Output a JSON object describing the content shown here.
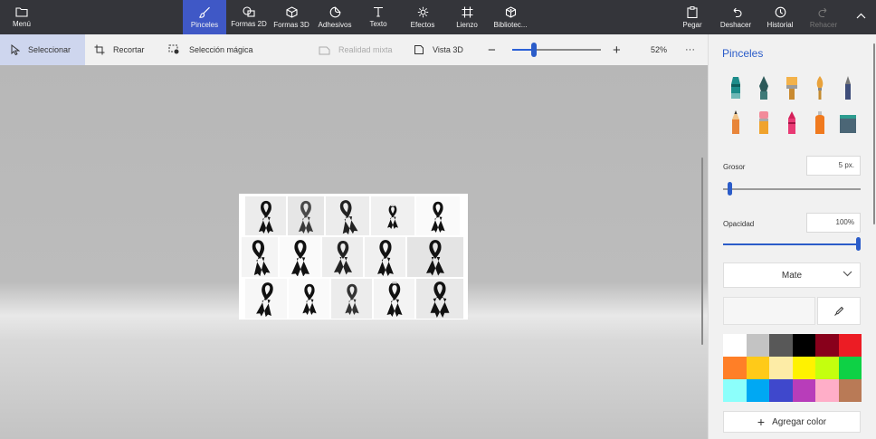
{
  "topbar": {
    "menu": "Menú",
    "tools": [
      "Pinceles",
      "Formas 2D",
      "Formas 3D",
      "Adhesivos",
      "Texto",
      "Efectos",
      "Lienzo",
      "Bibliotec..."
    ],
    "pegar": "Pegar",
    "deshacer": "Deshacer",
    "historial": "Historial",
    "rehacer": "Rehacer",
    "active_tool": "Pinceles"
  },
  "toolbar": {
    "seleccionar": "Seleccionar",
    "recortar": "Recortar",
    "seleccion_magica": "Selección mágica",
    "realidad_mixta": "Realidad mixta",
    "vista_3d": "Vista 3D",
    "zoom_out": "−",
    "zoom_in": "+",
    "zoom_percent": "52%",
    "more": "···"
  },
  "panel": {
    "title": "Pinceles",
    "grosor_label": "Grosor",
    "grosor_value": "5 px.",
    "opacidad_label": "Opacidad",
    "opacidad_value": "100%",
    "finish": "Mate",
    "add_color": "Agregar color",
    "brushes": [
      "marker",
      "calligraphy-pen",
      "oil-brush",
      "watercolor-brush",
      "pixel-pen",
      "pencil",
      "eraser",
      "crayon",
      "spray-can",
      "fill-bucket"
    ],
    "palette": [
      "#ffffff",
      "#c3c3c3",
      "#585858",
      "#000000",
      "#88001b",
      "#ec1c24",
      "#ff7f27",
      "#ffca18",
      "#fdeca6",
      "#fff200",
      "#c4ff0e",
      "#0ed145",
      "#8cfffb",
      "#00a8f3",
      "#3f48cc",
      "#b83dba",
      "#ffaec8",
      "#b97a56"
    ]
  },
  "colors": {
    "topbar_bg": "#34353a",
    "active_tool_bg": "#3f58c6",
    "accent": "#2b5cc9",
    "toolbar_bg": "#f1f1f1",
    "canvas_bg": "#bcbcbc"
  }
}
